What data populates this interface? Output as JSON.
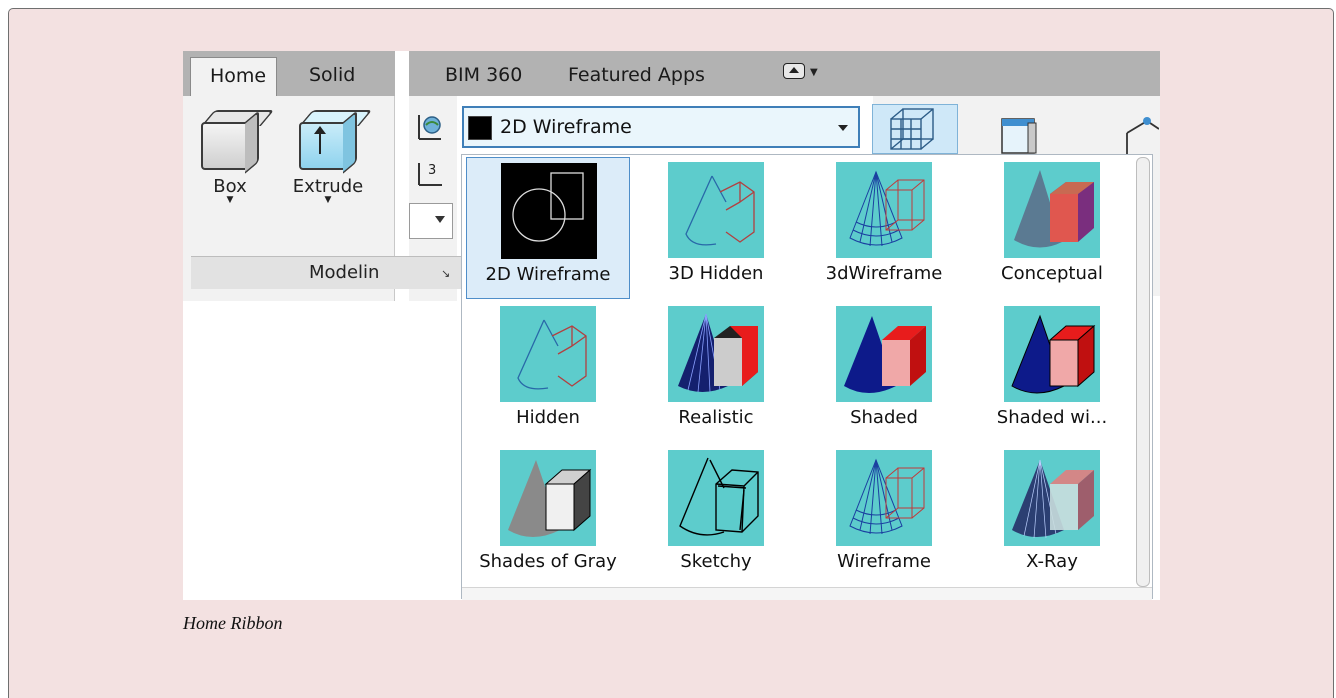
{
  "tabs": {
    "home": "Home",
    "solid": "Solid",
    "bim360": "BIM 360",
    "featured_apps": "Featured Apps"
  },
  "modeling": {
    "box_label": "Box",
    "extrude_label": "Extrude",
    "panel_title": "Modelin"
  },
  "visual_styles": {
    "current": "2D Wireframe",
    "items": [
      {
        "label": "2D Wireframe",
        "icon": "2d-wireframe-thumb",
        "selected": true
      },
      {
        "label": "3D Hidden",
        "icon": "3d-hidden-thumb"
      },
      {
        "label": "3dWireframe",
        "icon": "3d-wireframe-thumb"
      },
      {
        "label": "Conceptual",
        "icon": "conceptual-thumb"
      },
      {
        "label": "Hidden",
        "icon": "hidden-thumb"
      },
      {
        "label": "Realistic",
        "icon": "realistic-thumb"
      },
      {
        "label": "Shaded",
        "icon": "shaded-thumb"
      },
      {
        "label": "Shaded wi...",
        "icon": "shaded-with-edges-thumb"
      },
      {
        "label": "Shades of Gray",
        "icon": "shades-of-gray-thumb"
      },
      {
        "label": "Sketchy",
        "icon": "sketchy-thumb"
      },
      {
        "label": "Wireframe",
        "icon": "wireframe-thumb"
      },
      {
        "label": "X-Ray",
        "icon": "x-ray-thumb"
      }
    ]
  },
  "caption": "Home Ribbon",
  "colors": {
    "thumb_bg": "#5dcccc",
    "accent": "#3f7fb8",
    "page_bg": "#f3e1e1"
  }
}
